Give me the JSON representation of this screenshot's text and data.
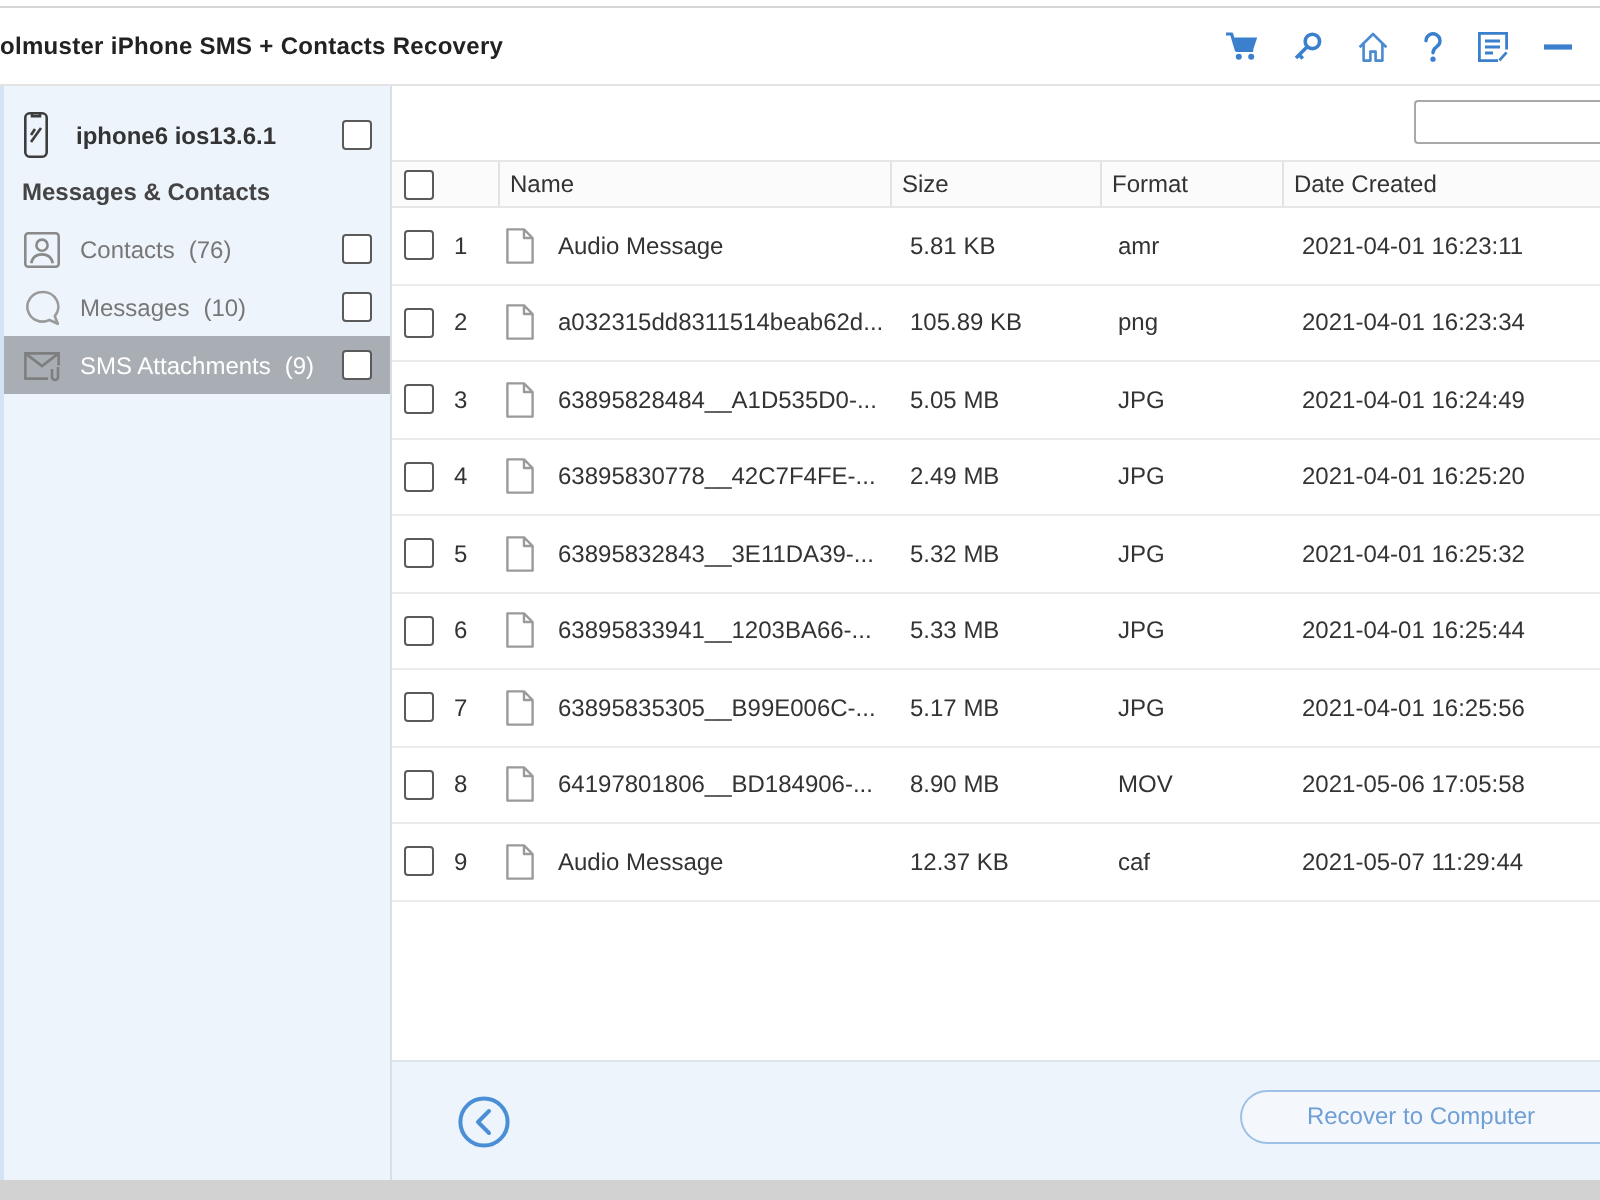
{
  "window": {
    "title": "olmuster iPhone SMS + Contacts Recovery"
  },
  "sidebar": {
    "device": {
      "name": "iphone6 ios13.6.1",
      "checked": false
    },
    "section_title": "Messages & Contacts",
    "items": [
      {
        "kind": "contacts",
        "label": "Contacts",
        "count": "(76)",
        "selected": false,
        "checked": false
      },
      {
        "kind": "messages",
        "label": "Messages",
        "count": "(10)",
        "selected": false,
        "checked": false
      },
      {
        "kind": "attachments",
        "label": "SMS Attachments",
        "count": "(9)",
        "selected": true,
        "checked": false
      }
    ]
  },
  "table": {
    "all_checked": false,
    "columns": [
      "Name",
      "Size",
      "Format",
      "Date Created"
    ],
    "rows": [
      {
        "number": "1",
        "name": "Audio Message",
        "size": "5.81 KB",
        "format": "amr",
        "date_created": "2021-04-01 16:23:11",
        "checked": false
      },
      {
        "number": "2",
        "name": "a032315dd8311514beab62d...",
        "size": "105.89 KB",
        "format": "png",
        "date_created": "2021-04-01 16:23:34",
        "checked": false
      },
      {
        "number": "3",
        "name": "63895828484__A1D535D0-...",
        "size": "5.05 MB",
        "format": "JPG",
        "date_created": "2021-04-01 16:24:49",
        "checked": false
      },
      {
        "number": "4",
        "name": "63895830778__42C7F4FE-...",
        "size": "2.49 MB",
        "format": "JPG",
        "date_created": "2021-04-01 16:25:20",
        "checked": false
      },
      {
        "number": "5",
        "name": "63895832843__3E11DA39-...",
        "size": "5.32 MB",
        "format": "JPG",
        "date_created": "2021-04-01 16:25:32",
        "checked": false
      },
      {
        "number": "6",
        "name": "63895833941__1203BA66-...",
        "size": "5.33 MB",
        "format": "JPG",
        "date_created": "2021-04-01 16:25:44",
        "checked": false
      },
      {
        "number": "7",
        "name": "63895835305__B99E006C-...",
        "size": "5.17 MB",
        "format": "JPG",
        "date_created": "2021-04-01 16:25:56",
        "checked": false
      },
      {
        "number": "8",
        "name": "64197801806__BD184906-...",
        "size": "8.90 MB",
        "format": "MOV",
        "date_created": "2021-05-06 17:05:58",
        "checked": false
      },
      {
        "number": "9",
        "name": "Audio Message",
        "size": "12.37 KB",
        "format": "caf",
        "date_created": "2021-05-07 11:29:44",
        "checked": false
      }
    ]
  },
  "footer": {
    "recover_button": {
      "label": "Recover to Computer",
      "disabled": true
    }
  }
}
